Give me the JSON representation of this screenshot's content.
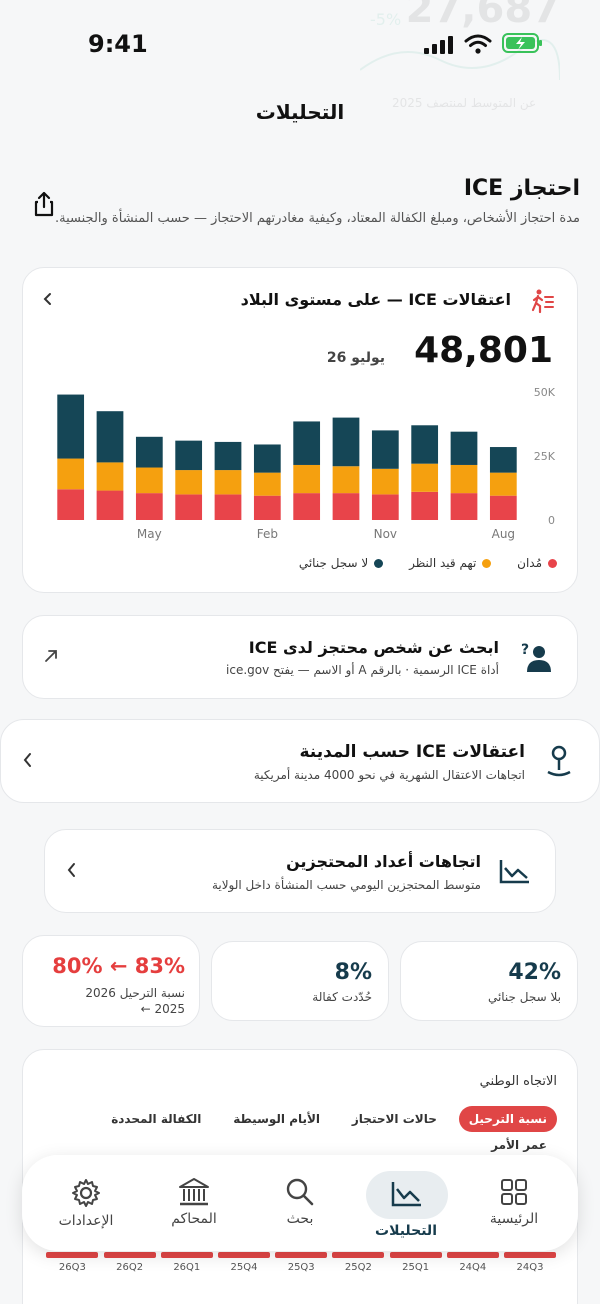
{
  "ghost": {
    "number": "27,687",
    "percent": "-5%",
    "subtitle": "عن المتوسط لمنتصف 2025"
  },
  "status": {
    "time": "9:41"
  },
  "nav": {
    "title": "التحليلات"
  },
  "section": {
    "title": "احتجاز ICE",
    "description": "مدة احتجاز الأشخاص، ومبلغ الكفالة المعتاد، وكيفية مغادرتهم الاحتجاز — حسب المنشأة والجنسية."
  },
  "chart_card": {
    "title": "اعتقالات ICE — على مستوى البلاد",
    "value": "48,801",
    "date": "يوليو 26"
  },
  "chart_data": {
    "type": "bar",
    "stacked": true,
    "categories": [
      "",
      "",
      "May",
      "",
      "",
      "Feb",
      "",
      "",
      "Nov",
      "",
      "",
      "Aug"
    ],
    "series": [
      {
        "name": "مُدان",
        "color": "#e8444a",
        "values": [
          12000,
          11500,
          10500,
          10000,
          10000,
          9500,
          10500,
          10500,
          10000,
          11000,
          10500,
          9500
        ]
      },
      {
        "name": "تهم قيد النظر",
        "color": "#f5a00f",
        "values": [
          12000,
          11000,
          10000,
          9500,
          9500,
          9000,
          11000,
          10500,
          10000,
          11000,
          11000,
          9000
        ]
      },
      {
        "name": "لا سجل جنائي",
        "color": "#154656",
        "values": [
          25000,
          20000,
          12000,
          11500,
          11000,
          11000,
          17000,
          19000,
          15000,
          15000,
          13000,
          10000
        ]
      }
    ],
    "yticks": [
      "50K",
      "25K",
      "0"
    ],
    "ylim": [
      0,
      50000
    ],
    "legend_position": "bottom"
  },
  "search_card": {
    "title": "ابحث عن شخص محتجز لدى ICE",
    "subtitle": "أداة ICE الرسمية · بالرقم A أو الاسم — يفتح ice.gov"
  },
  "city_card": {
    "title": "اعتقالات ICE حسب المدينة",
    "subtitle": "اتجاهات الاعتقال الشهرية في نحو 4000 مدينة أمريكية"
  },
  "trend_card": {
    "title": "اتجاهات أعداد المحتجزين",
    "subtitle": "متوسط المحتجزين اليومي حسب المنشأة داخل الولاية"
  },
  "stats": [
    {
      "value": "42%",
      "label": "بلا سجل جنائي"
    },
    {
      "value": "8%",
      "label": "حُدّدت كفالة"
    },
    {
      "value": "80% ← 83%",
      "label": "نسبة الترحيل 2026",
      "label2": "← 2025"
    }
  ],
  "national": {
    "heading": "الاتجاه الوطني",
    "tabs": [
      "نسبة الترحيل",
      "حالات الاحتجاز",
      "الأيام الوسيطة",
      "الكفالة المحددة",
      "عمر الأمر"
    ]
  },
  "tabbar": [
    {
      "label": "الرئيسية",
      "icon": "grid-icon"
    },
    {
      "label": "التحليلات",
      "icon": "chart-icon"
    },
    {
      "label": "بحث",
      "icon": "search-icon"
    },
    {
      "label": "المحاكم",
      "icon": "courthouse-icon"
    },
    {
      "label": "الإعدادات",
      "icon": "gear-icon"
    }
  ],
  "quarters": [
    "24Q3",
    "24Q4",
    "25Q1",
    "25Q2",
    "25Q3",
    "25Q4",
    "26Q1",
    "26Q2",
    "26Q3"
  ]
}
